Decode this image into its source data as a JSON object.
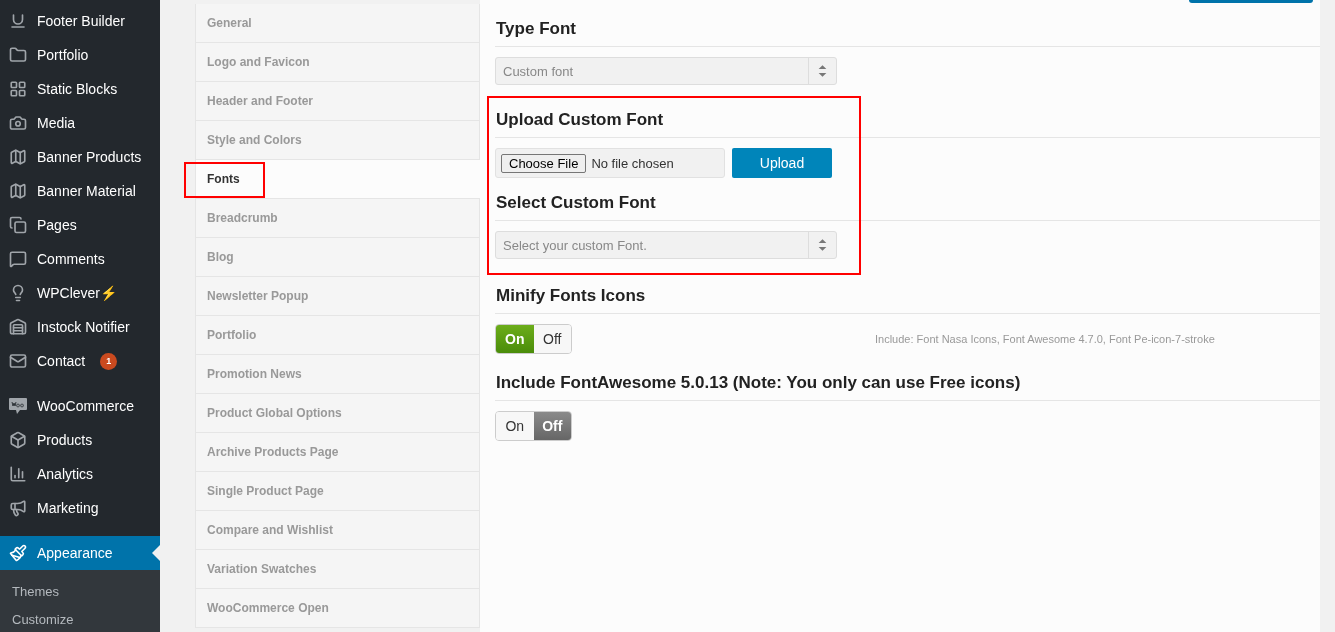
{
  "sidebar": {
    "groups": [
      {
        "items": [
          {
            "label": "Footer Builder",
            "selected": false
          },
          {
            "label": "Portfolio",
            "selected": false
          },
          {
            "label": "Static Blocks",
            "selected": false
          },
          {
            "label": "Media",
            "selected": false
          },
          {
            "label": "Banner Products",
            "selected": false
          },
          {
            "label": "Banner Material",
            "selected": false
          },
          {
            "label": "Pages",
            "selected": false
          },
          {
            "label": "Comments",
            "selected": false
          },
          {
            "label": "WPClever⚡",
            "selected": false
          },
          {
            "label": "Instock Notifier",
            "selected": false
          },
          {
            "label": "Contact",
            "selected": false,
            "badge": "1"
          }
        ]
      },
      {
        "items": [
          {
            "label": "WooCommerce",
            "selected": false
          },
          {
            "label": "Products",
            "selected": false
          },
          {
            "label": "Analytics",
            "selected": false
          },
          {
            "label": "Marketing",
            "selected": false
          }
        ]
      },
      {
        "items": [
          {
            "label": "Appearance",
            "selected": true
          }
        ]
      }
    ],
    "submenu": [
      {
        "label": "Themes"
      },
      {
        "label": "Customize"
      }
    ]
  },
  "option_tabs": [
    {
      "label": "General",
      "selected": false
    },
    {
      "label": "Logo and Favicon",
      "selected": false
    },
    {
      "label": "Header and Footer",
      "selected": false
    },
    {
      "label": "Style and Colors",
      "selected": false
    },
    {
      "label": "Fonts",
      "selected": true,
      "highlighted": true
    },
    {
      "label": "Breadcrumb",
      "selected": false
    },
    {
      "label": "Blog",
      "selected": false
    },
    {
      "label": "Newsletter Popup",
      "selected": false
    },
    {
      "label": "Portfolio",
      "selected": false
    },
    {
      "label": "Promotion News",
      "selected": false
    },
    {
      "label": "Product Global Options",
      "selected": false
    },
    {
      "label": "Archive Products Page",
      "selected": false
    },
    {
      "label": "Single Product Page",
      "selected": false
    },
    {
      "label": "Compare and Wishlist",
      "selected": false
    },
    {
      "label": "Variation Swatches",
      "selected": false
    },
    {
      "label": "WooCommerce Open",
      "selected": false
    }
  ],
  "sections": [
    {
      "kind": "select",
      "title": "Type Font",
      "value": "Custom font"
    },
    {
      "kind": "upload",
      "title": "Upload Custom Font",
      "highlighted": true,
      "file_button": "Choose File",
      "file_status": "No file chosen",
      "upload_button": "Upload"
    },
    {
      "kind": "select",
      "title": "Select Custom Font",
      "highlighted": true,
      "value": "Select your custom Font."
    },
    {
      "kind": "toggle",
      "title": "Minify Fonts Icons",
      "on_label": "On",
      "off_label": "Off",
      "on": true,
      "note": "Include: Font Nasa Icons, Font Awesome 4.7.0, Font Pe-icon-7-stroke"
    },
    {
      "kind": "toggle",
      "title": "Include FontAwesome 5.0.13 (Note: You only can use Free icons)",
      "on_label": "On",
      "off_label": "Off",
      "on": false
    }
  ]
}
